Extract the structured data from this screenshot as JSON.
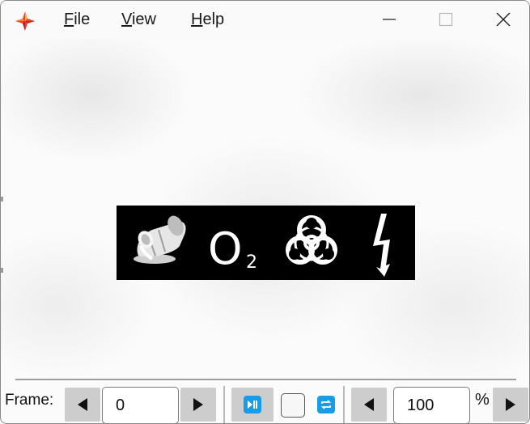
{
  "menu": {
    "file": {
      "accel": "F",
      "rest": "ile"
    },
    "view": {
      "accel": "V",
      "rest": "iew"
    },
    "help": {
      "accel": "H",
      "rest": "elp"
    }
  },
  "window_controls": {
    "minimize_icon": "minimize-icon",
    "maximize_icon": "maximize-icon",
    "close_icon": "close-icon"
  },
  "sprite_icons": [
    "paint-bucket-spill-icon",
    "oxygen-icon",
    "biohazard-icon",
    "electricity-bolt-icon"
  ],
  "sprite_text": {
    "o": "O",
    "sub": "2"
  },
  "controls": {
    "frame_label": "Frame:",
    "frame_value": "0",
    "zoom_value": "100",
    "zoom_unit": "%",
    "play_pause_icon": "play-pause-icon",
    "loop_icon": "loop-icon",
    "checkbox_checked": false
  },
  "colors": {
    "accent": "#1a9be6",
    "sprite_background": "#000000"
  }
}
